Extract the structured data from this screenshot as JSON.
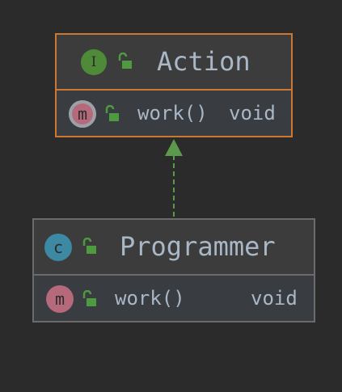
{
  "nodes": [
    {
      "name": "Action",
      "kind": "interface",
      "kind_letter": "I",
      "method": "work()",
      "return_type": "void"
    },
    {
      "name": "Programmer",
      "kind": "class",
      "kind_letter": "c",
      "method": "work()",
      "return_type": "void"
    }
  ],
  "method_letter": "m",
  "relation": {
    "from": "Programmer",
    "to": "Action",
    "type": "implements"
  },
  "colors": {
    "background": "#2b2b2b",
    "selected_border": "#cc7832",
    "border": "#6b6b6b",
    "text": "#a9b7c6",
    "interface": "#4f8a38",
    "class": "#3d88a3",
    "method": "#b5697a",
    "lock": "#4e9a3f",
    "arrow": "#5b9a4c"
  }
}
